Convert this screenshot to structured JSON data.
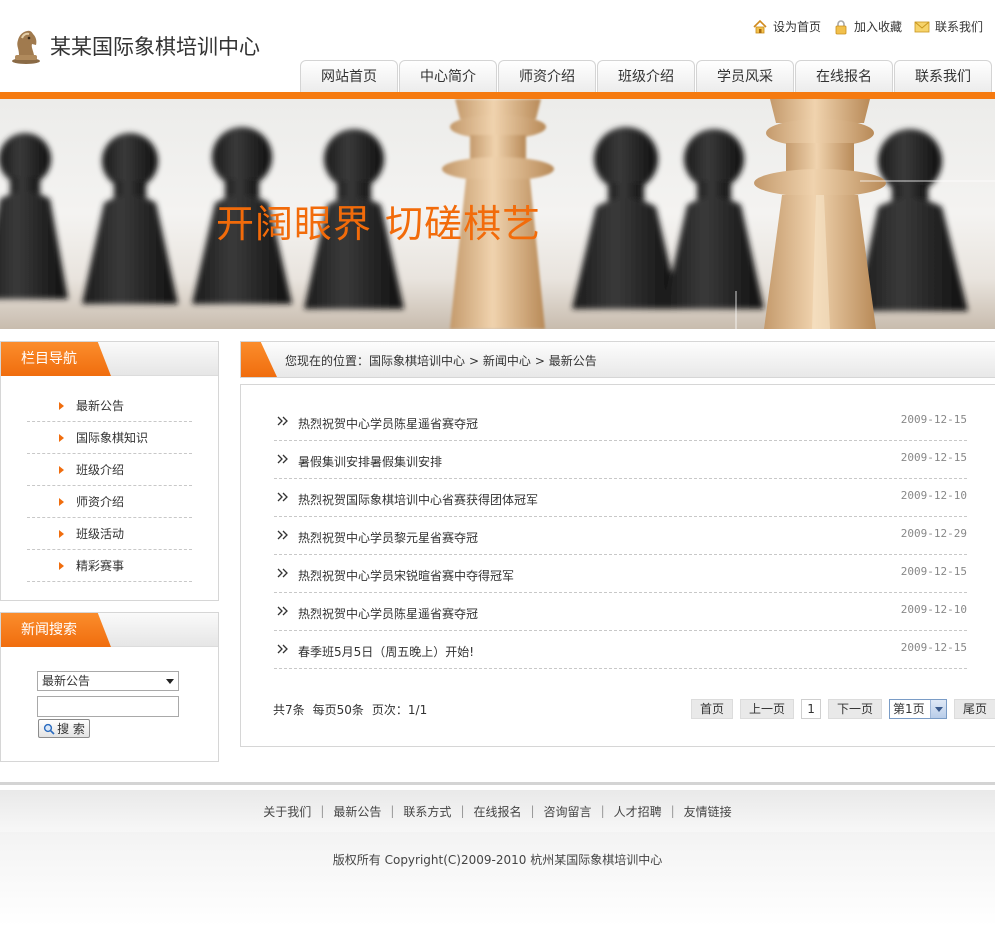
{
  "header": {
    "site_name": "某某国际象棋培训中心",
    "top_links": [
      {
        "label": "设为首页",
        "icon": "home-icon"
      },
      {
        "label": "加入收藏",
        "icon": "lock-icon"
      },
      {
        "label": "联系我们",
        "icon": "mail-icon"
      }
    ],
    "nav": [
      "网站首页",
      "中心简介",
      "师资介绍",
      "班级介绍",
      "学员风采",
      "在线报名",
      "联系我们"
    ],
    "accent_color": "#f57a10"
  },
  "banner": {
    "slogan": "开阔眼界 切磋棋艺"
  },
  "sidebar": {
    "nav_title": "栏目导航",
    "nav_items": [
      "最新公告",
      "国际象棋知识",
      "班级介绍",
      "师资介绍",
      "班级活动",
      "精彩赛事"
    ],
    "search_title": "新闻搜索",
    "search_select": "最新公告",
    "search_input": "",
    "search_button": "搜 索"
  },
  "breadcrumb": {
    "prefix": "您现在的位置：国际象棋培训中心",
    "items": [
      "> 新闻中心",
      "> 最新公告"
    ]
  },
  "news": [
    {
      "title": "热烈祝贺中心学员陈星遥省赛夺冠",
      "date": "2009-12-15"
    },
    {
      "title": "暑假集训安排暑假集训安排",
      "date": "2009-12-15"
    },
    {
      "title": "热烈祝贺国际象棋培训中心省赛获得团体冠军",
      "date": "2009-12-10"
    },
    {
      "title": "热烈祝贺中心学员黎元星省赛夺冠",
      "date": "2009-12-29"
    },
    {
      "title": "热烈祝贺中心学员宋锐暄省赛中夺得冠军",
      "date": "2009-12-15"
    },
    {
      "title": "热烈祝贺中心学员陈星遥省赛夺冠",
      "date": "2009-12-10"
    },
    {
      "title": "春季班5月5日（周五晚上）开始!",
      "date": "2009-12-15"
    }
  ],
  "pager": {
    "total": "共7条",
    "per_page": "每页50条",
    "pages": "页次：1/1",
    "first": "首页",
    "prev": "上一页",
    "current": "1",
    "next": "下一页",
    "select": "第1页",
    "last": "尾页"
  },
  "footer": {
    "links": [
      "关于我们",
      "最新公告",
      "联系方式",
      "在线报名",
      "咨询留言",
      "人才招聘",
      "友情链接"
    ],
    "copyright": "版权所有  Copyright(C)2009-2010 杭州某国际象棋培训中心"
  }
}
